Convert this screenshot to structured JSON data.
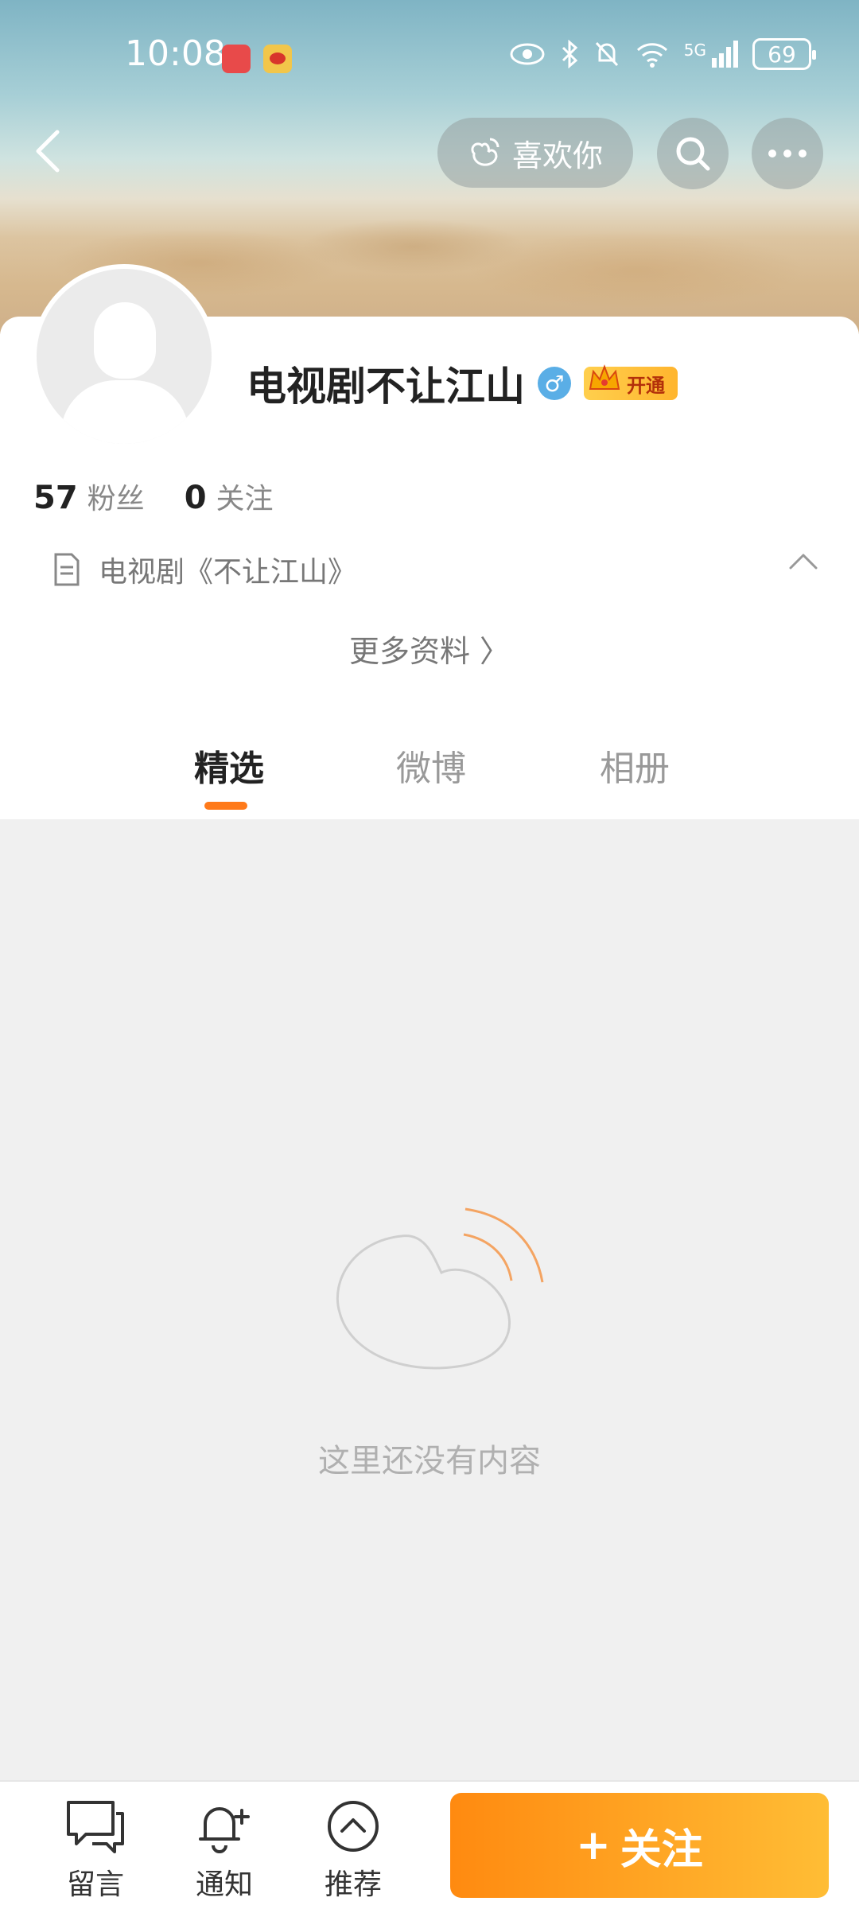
{
  "status_bar": {
    "time": "10:08",
    "network": "5G",
    "battery": "69"
  },
  "header": {
    "back_icon": "chevron-left-icon",
    "like_label": "喜欢你",
    "search_icon": "search-icon",
    "more_icon": "more-dots-icon"
  },
  "profile": {
    "name": "电视剧不让江山",
    "gender_symbol": "♂",
    "vip_label": "开通",
    "followers_count": "57",
    "followers_label": "粉丝",
    "following_count": "0",
    "following_label": "关注",
    "bio": "电视剧《不让江山》",
    "more_info": "更多资料 〉"
  },
  "tabs": [
    {
      "label": "精选",
      "active": true
    },
    {
      "label": "微博",
      "active": false
    },
    {
      "label": "相册",
      "active": false
    }
  ],
  "content": {
    "empty_text": "这里还没有内容"
  },
  "bottom_bar": {
    "message_label": "留言",
    "notify_label": "通知",
    "recommend_label": "推荐",
    "follow_label": "关注",
    "follow_prefix": "+"
  },
  "colors": {
    "accent": "#ff7a1a",
    "follow_gradient_start": "#ff8a10",
    "follow_gradient_end": "#ffbd35"
  }
}
